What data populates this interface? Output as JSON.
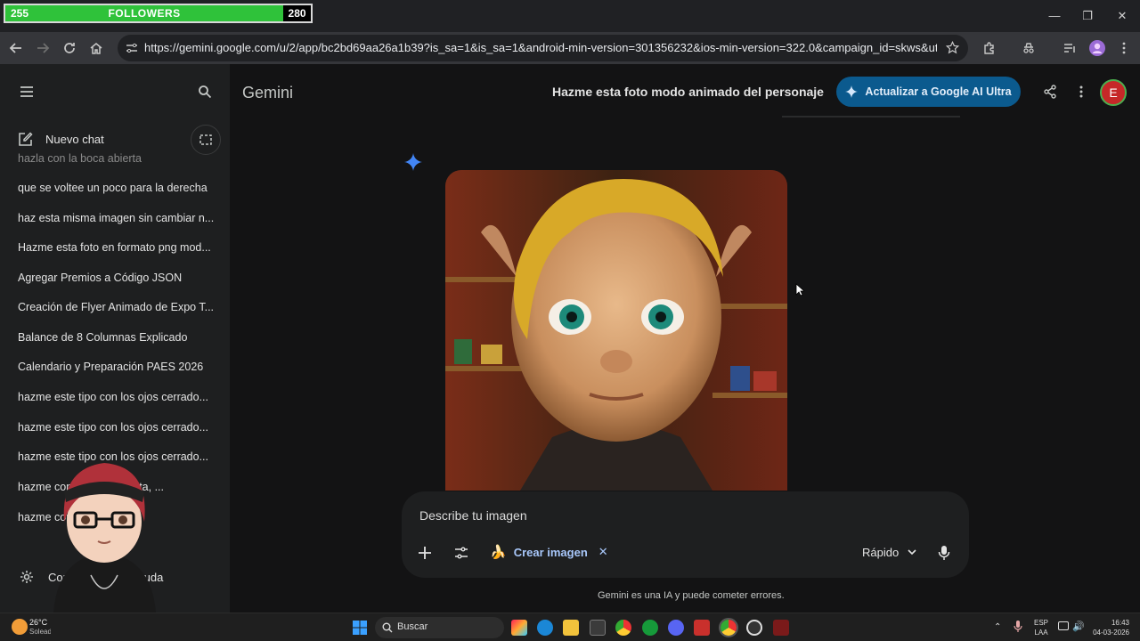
{
  "overlay": {
    "followers_current": "255",
    "followers_label": "FOLLOWERS",
    "followers_goal": "280",
    "progress_fraction": 0.91
  },
  "browser": {
    "url": "https://gemini.google.com/u/2/app/bc2bd69aa26a1b39?is_sa=1&is_sa=1&android-min-version=301356232&ios-min-version=322.0&campaign_id=skws&utm_source=s..."
  },
  "sidebar": {
    "new_chat": "Nuevo chat",
    "items": [
      "hazla con la boca abierta",
      "que se voltee un poco para la derecha",
      "haz esta misma imagen sin cambiar n...",
      "Hazme esta foto en formato png mod...",
      "Agregar Premios a Código JSON",
      "Creación de Flyer Animado de Expo T...",
      "Balance de 8 Columnas Explicado",
      "Calendario y Preparación PAES 2026",
      "hazme este tipo con los ojos cerrado...",
      "hazme este tipo con los ojos cerrado...",
      "hazme este tipo con los ojos cerrado...",
      "hazme con la boca abierta, ...",
      "hazme con rasgos f..."
    ],
    "settings": "Configuración y ayuda"
  },
  "header": {
    "brand": "Gemini",
    "title": "Hazme esta foto modo animado del personaje",
    "upgrade_label": "Actualizar a Google AI Ultra",
    "avatar_letter": "E"
  },
  "composer": {
    "placeholder": "Describe tu imagen",
    "tool_label": "Crear imagen",
    "mode_label": "Rápido"
  },
  "footer_note": "Gemini es una IA y puede cometer errores.",
  "taskbar": {
    "weather_temp": "26°C",
    "weather_desc": "Soleado",
    "search_label": "Buscar",
    "lang_top": "ESP",
    "lang_bottom": "LAA",
    "time": "16:43",
    "date": "04-03-2026"
  },
  "colors": {
    "upgrade_bg": "#0b5a8e",
    "progress_fill": "#2fc23a",
    "avatar_bg": "#c62828"
  }
}
